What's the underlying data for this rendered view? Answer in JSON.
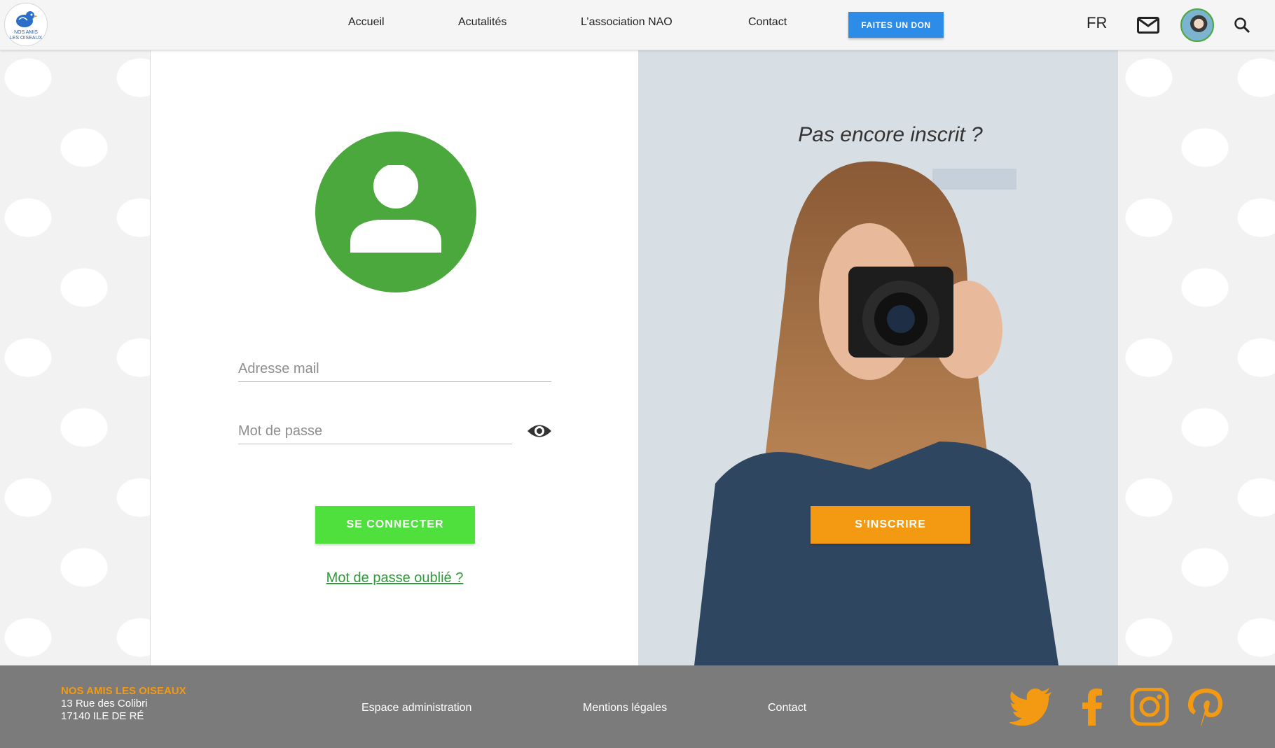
{
  "header": {
    "logo_text": [
      "NOS AMIS",
      "LES OISEAUX"
    ],
    "nav": [
      "Accueil",
      "Acutalités",
      "L’association NAO",
      "Contact"
    ],
    "donate_label": "FAITES UN DON",
    "language": "FR"
  },
  "login": {
    "email_placeholder": "Adresse mail",
    "password_placeholder": "Mot de passe",
    "connect_label": "SE CONNECTER",
    "forgot_label": "Mot de passe oublié ?"
  },
  "signup": {
    "title": "Pas encore inscrit ?",
    "button_label": "S’INSCRIRE"
  },
  "footer": {
    "org_name": "NOS AMIS LES OISEAUX",
    "address_line1": "13 Rue des Colibri",
    "address_line2": "17140 ILE DE RÉ",
    "links": [
      "Espace administration",
      "Mentions légales",
      "Contact"
    ],
    "social": [
      "twitter-icon",
      "facebook-icon",
      "instagram-icon",
      "pinterest-icon"
    ]
  },
  "colors": {
    "primary_green": "#4aa83c",
    "connect_green": "#4fe03d",
    "orange": "#f39a12",
    "donate_blue": "#2d8ce8",
    "footer_grey": "#7b7b7b"
  }
}
